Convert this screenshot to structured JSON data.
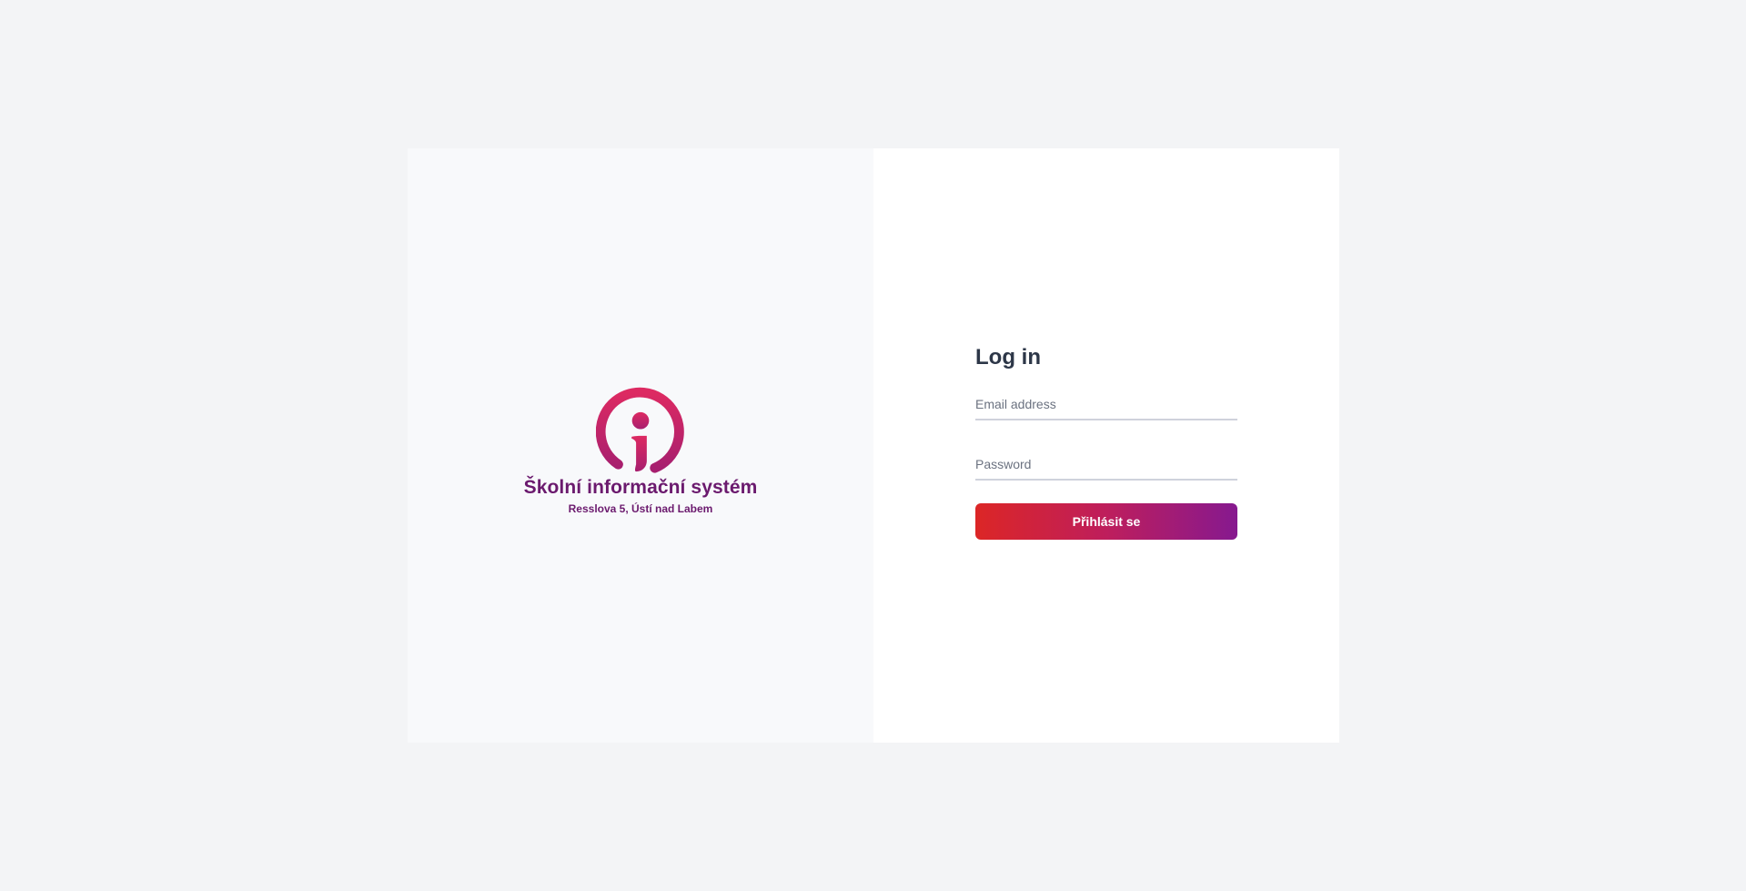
{
  "brand": {
    "logo_icon": "info-circle-logo-icon",
    "school_name": "Školní informační systém",
    "address": "Resslova 5, Ústí nad Labem"
  },
  "login": {
    "title": "Log in",
    "email": {
      "placeholder": "Email address",
      "value": ""
    },
    "password": {
      "placeholder": "Password",
      "value": ""
    },
    "submit_label": "Přihlásit se"
  },
  "colors": {
    "brand_purple": "#6b1a6e",
    "gradient_start": "#dc2626",
    "gradient_end": "#86198f",
    "logo_start": "#dd2a62",
    "logo_end": "#a71f6f"
  }
}
